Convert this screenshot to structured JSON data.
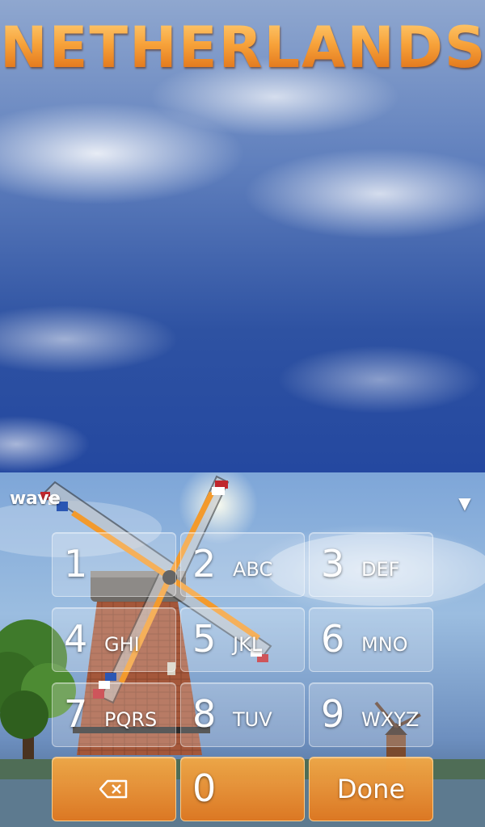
{
  "header": {
    "title": "NETHERLANDS"
  },
  "keyboard": {
    "brand_label": "wave",
    "collapse_icon": "chevron-down-icon",
    "keys": [
      {
        "digit": "1",
        "letters": ""
      },
      {
        "digit": "2",
        "letters": "ABC"
      },
      {
        "digit": "3",
        "letters": "DEF"
      },
      {
        "digit": "4",
        "letters": "GHI"
      },
      {
        "digit": "5",
        "letters": "JKL"
      },
      {
        "digit": "6",
        "letters": "MNO"
      },
      {
        "digit": "7",
        "letters": "PQRS"
      },
      {
        "digit": "8",
        "letters": "TUV"
      },
      {
        "digit": "9",
        "letters": "WXYZ"
      }
    ],
    "backspace_icon": "backspace-icon",
    "zero_label": "0",
    "done_label": "Done"
  },
  "colors": {
    "title_orange": "#f08a24",
    "sky_blue": "#2448a0",
    "action_key_orange": "#e2781e"
  }
}
